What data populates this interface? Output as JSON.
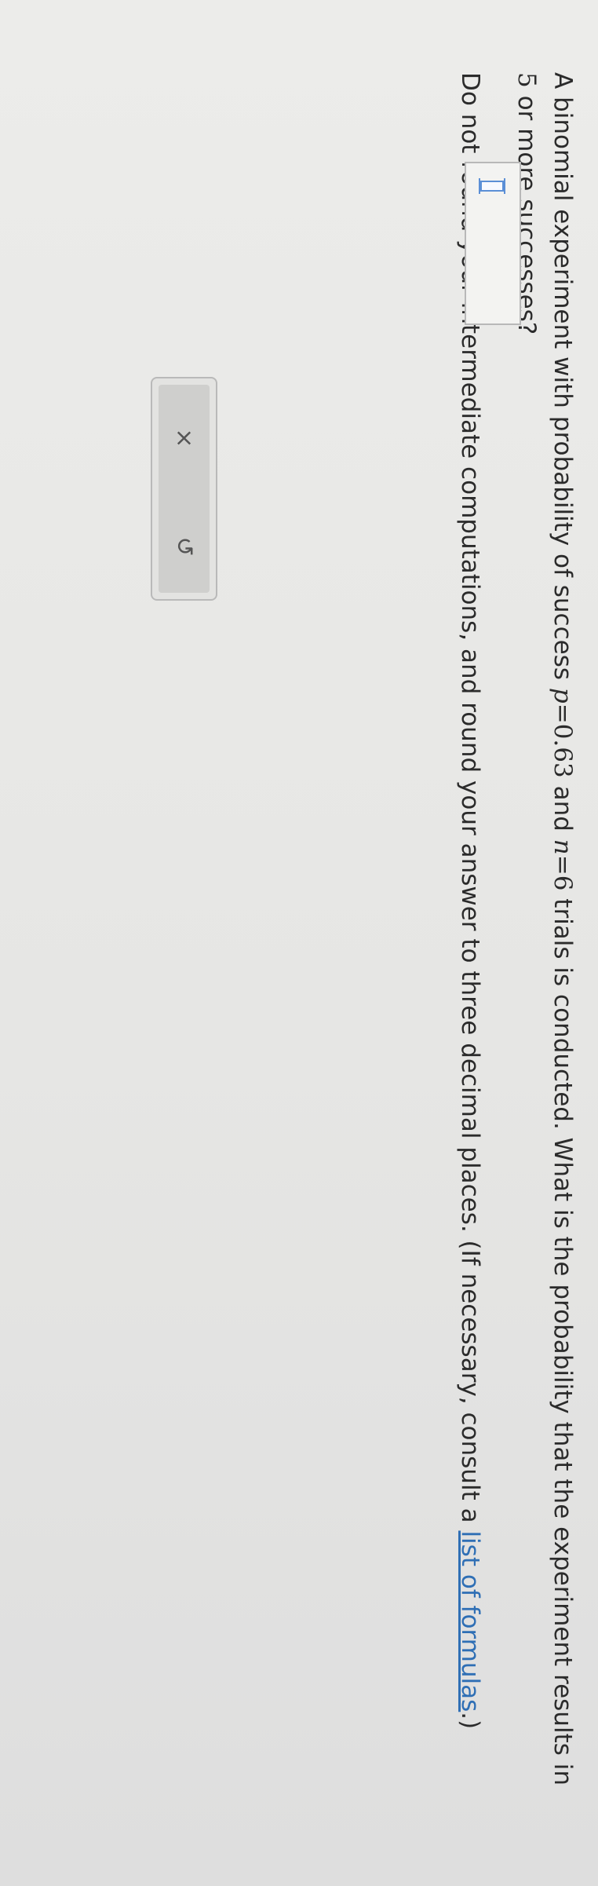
{
  "question": {
    "line1_pre": "A binomial experiment with probability of success ",
    "p_var": "p",
    "p_eq": "=0.63",
    "and": " and ",
    "n_var": "n",
    "n_eq": "=6",
    "line1_post": " trials is conducted. What is the probability that the experiment results in ",
    "k_val": "5",
    "line1_end": " or more successes?",
    "instruction_pre": "Do not round your intermediate computations, and round your answer to three decimal places. (If necessary, consult a ",
    "link_text": "list of formulas",
    "instruction_post": ".)"
  },
  "answer": {
    "value": ""
  },
  "tools": {
    "clear_icon": "×",
    "undo_icon": "↺"
  }
}
